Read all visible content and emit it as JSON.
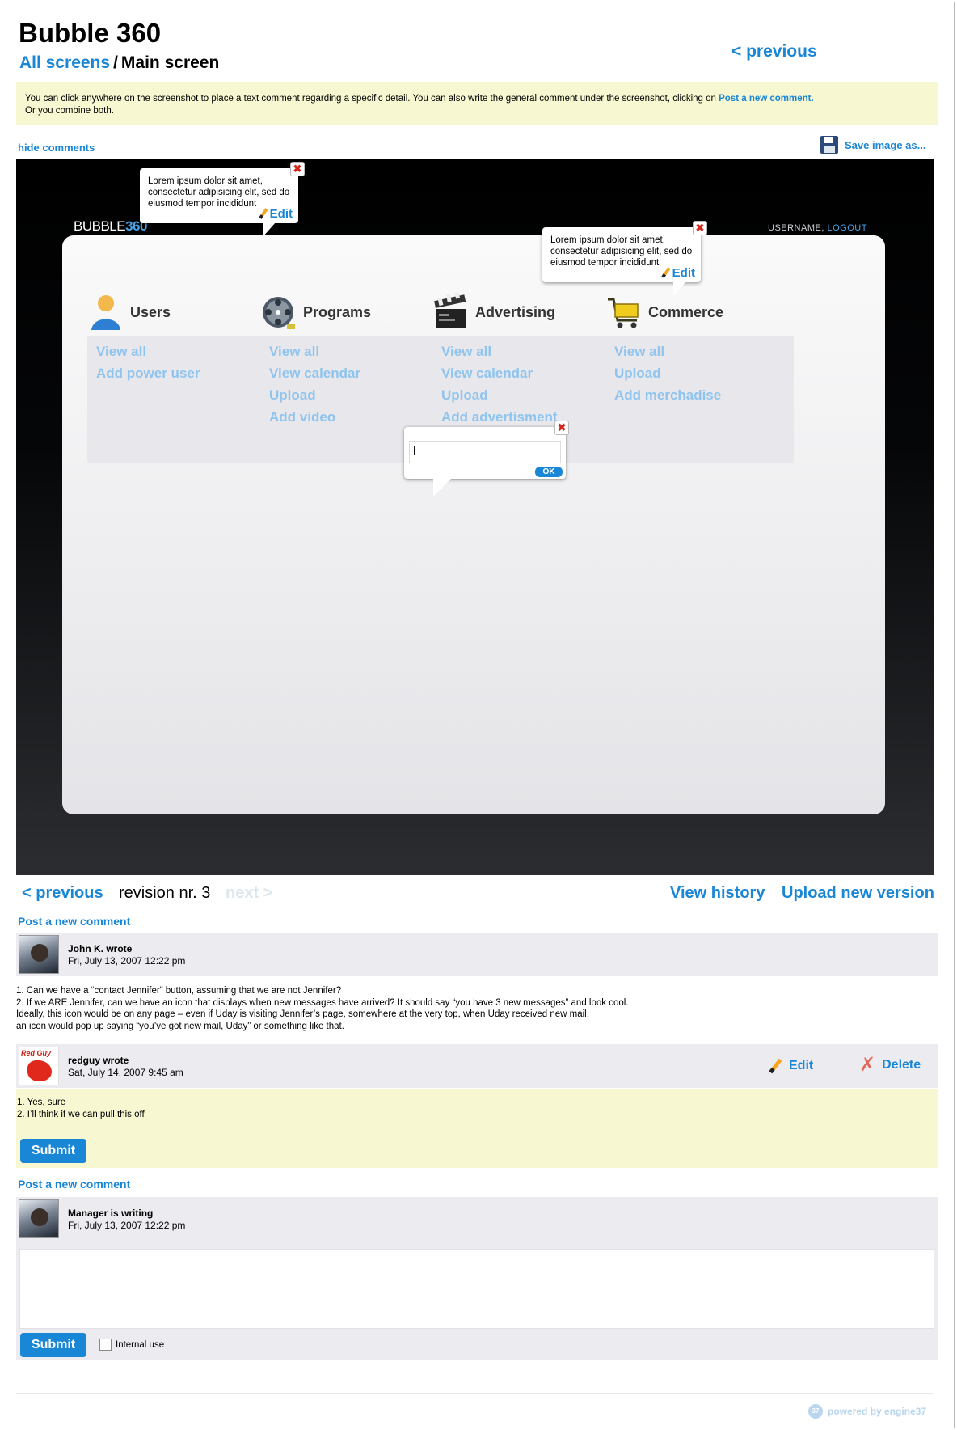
{
  "header": {
    "title": "Bubble 360",
    "breadcrumb_link": "All screens",
    "breadcrumb_sep": "/",
    "breadcrumb_current": "Main screen",
    "previous": "< previous"
  },
  "info": {
    "line1": "You can click anywhere on the screenshot to place a text comment regarding a specific detail. You can also write the general comment under  the screenshot, clicking on",
    "line1_link": "Post a new comment.",
    "line2": "Or you combine both."
  },
  "toolbar": {
    "hide_comments": "hide comments",
    "save_image": "Save image as..."
  },
  "screenshot": {
    "logo_text": "BUBBLE",
    "logo_accent": "360",
    "username": "USERNAME,",
    "logout": "LOGOUT",
    "columns": [
      {
        "label": "Users",
        "icon": "user-icon",
        "links": [
          "View all",
          "Add power user"
        ]
      },
      {
        "label": "Programs",
        "icon": "film-reel-icon",
        "links": [
          "View all",
          "View calendar",
          "Upload",
          "Add video"
        ]
      },
      {
        "label": "Advertising",
        "icon": "clapperboard-icon",
        "links": [
          "View all",
          "View calendar",
          "Upload",
          "Add advertisment"
        ]
      },
      {
        "label": "Commerce",
        "icon": "shopping-cart-icon",
        "links": [
          "View all",
          "Upload",
          "Add merchadise"
        ]
      }
    ],
    "bubbles": [
      {
        "text": "Lorem ipsum dolor sit amet, consectetur adipisicing elit, sed do eiusmod tempor incididunt",
        "edit": "Edit"
      },
      {
        "text": "Lorem ipsum dolor sit amet, consectetur adipisicing elit, sed do eiusmod tempor incididunt",
        "edit": "Edit"
      }
    ],
    "input_bubble": {
      "value": "|",
      "ok": "OK"
    },
    "close_glyph": "✖"
  },
  "revision": {
    "previous": "< previous",
    "label": "revision nr. 3",
    "next": "next >",
    "view_history": "View history",
    "upload_new_version": "Upload new version"
  },
  "post_new_comment": "Post a new comment",
  "comments": [
    {
      "author": "John K. wrote",
      "date": "Fri, July 13, 2007 12:22 pm",
      "lines": [
        "1. Can we have a “contact Jennifer” button, assuming that we are not Jennifer?",
        "2. If we ARE Jennifer, can we have an icon that displays when new messages have arrived?  It should say “you have 3 new messages” and look cool.",
        "Ideally, this icon would be on any page – even if Uday is visiting Jennifer’s page, somewhere at the very top, when Uday received new mail,",
        "an icon would pop up saying “you’ve got new mail, Uday” or something like that."
      ]
    },
    {
      "author": "redguy wrote",
      "date": "Sat, July 14, 2007 9:45 am",
      "avatar_text": "Red Guy",
      "edit": "Edit",
      "delete": "Delete",
      "lines": [
        "1. Yes, sure",
        "2. I’ll think if we can pull this off"
      ],
      "submit": "Submit"
    }
  ],
  "new_comment": {
    "author": "Manager is writing",
    "date": "Fri, July 13, 2007 12:22 pm",
    "submit": "Submit",
    "internal_use": "Internal use"
  },
  "footer": {
    "powered": "powered by engine37",
    "badge": "37"
  },
  "colors": {
    "accent": "#1a86d6",
    "info_bg": "#f7f7d2",
    "comment_bg": "#ebebf0"
  }
}
